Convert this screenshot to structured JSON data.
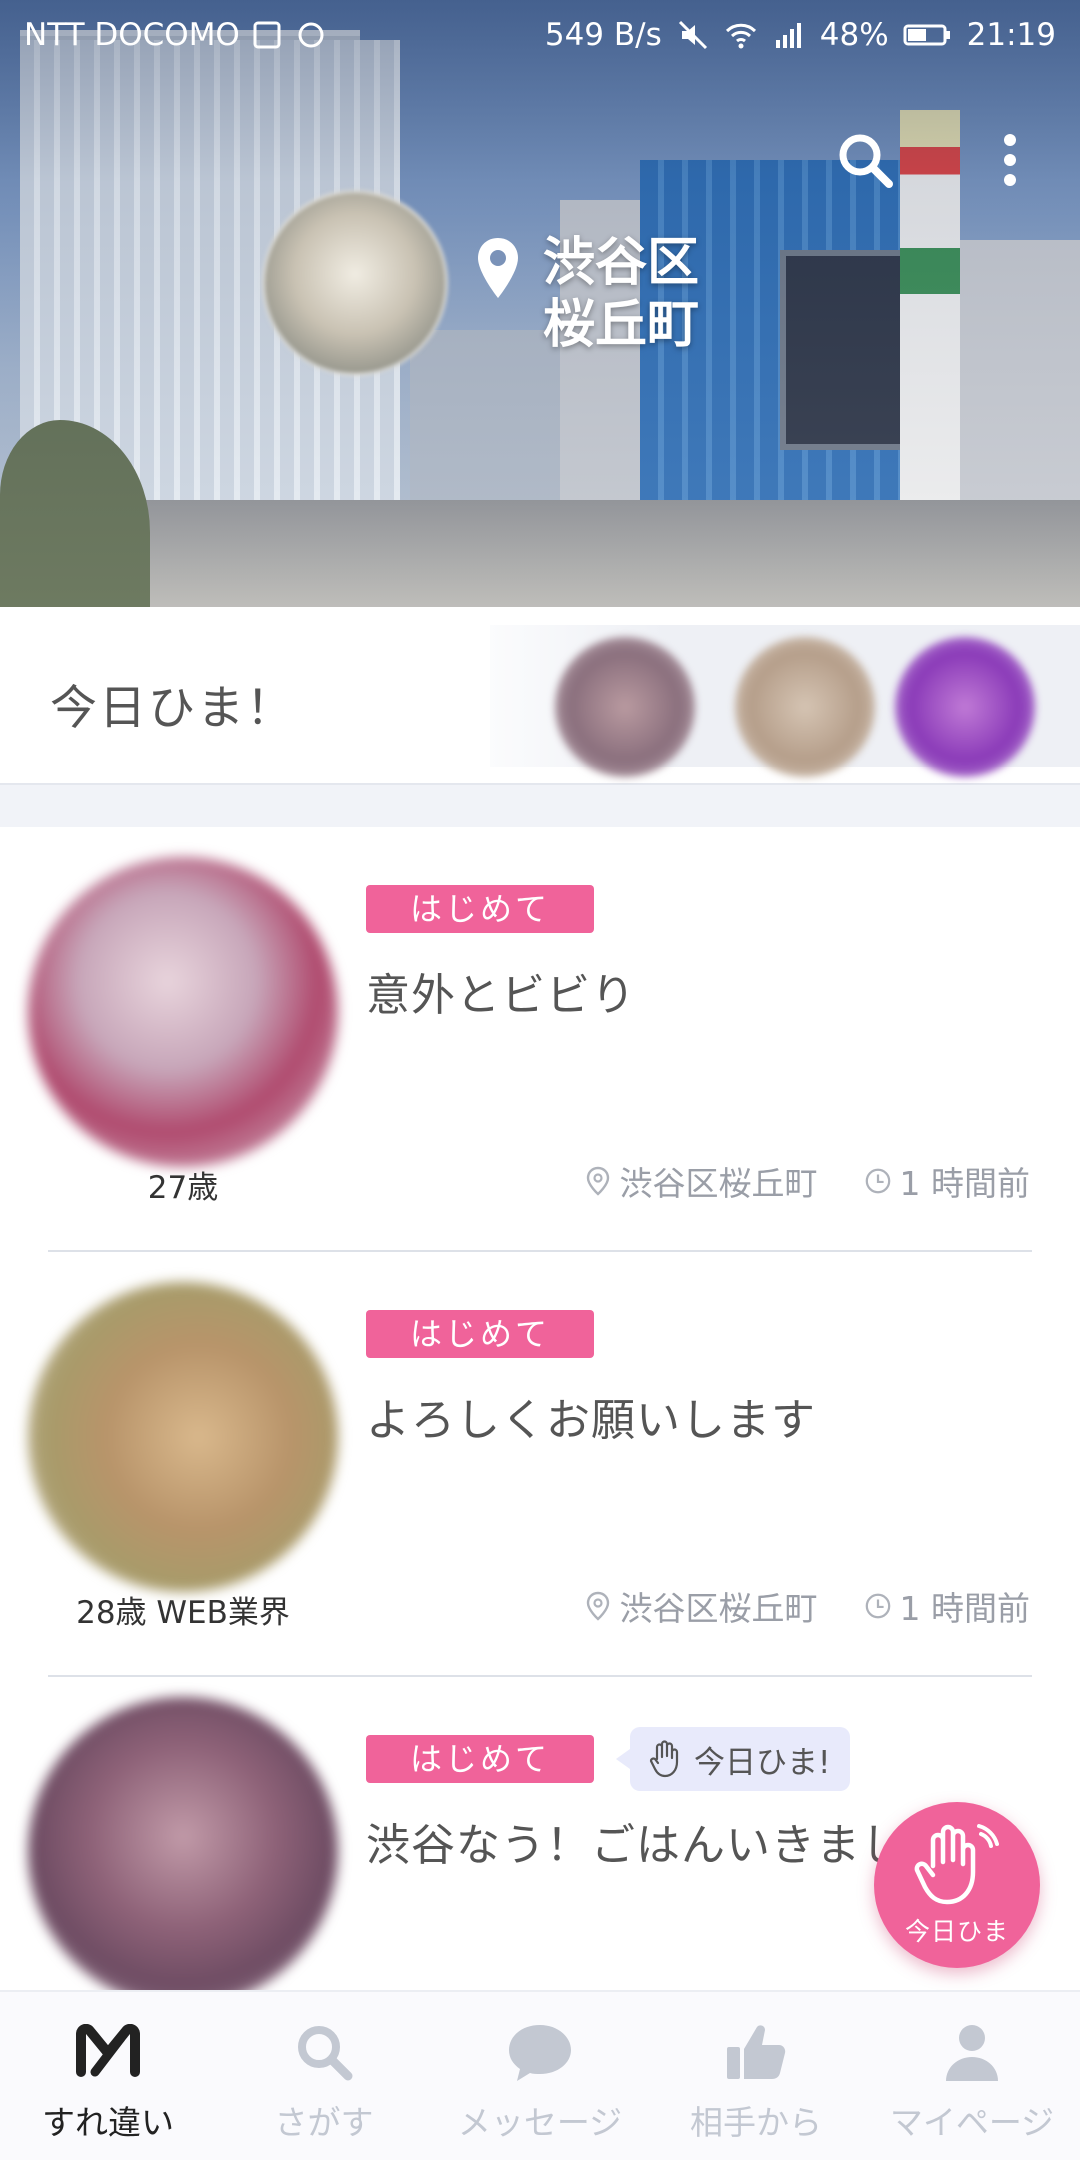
{
  "status_bar": {
    "carrier": "NTT DOCOMO",
    "net_speed": "549 B/s",
    "battery": "48%",
    "time": "21:19"
  },
  "header": {
    "location_line1": "渋谷区",
    "location_line2": "桜丘町"
  },
  "today_hima": {
    "title": "今日ひま！"
  },
  "posts": [
    {
      "badge": "はじめて",
      "message": "意外とビビり",
      "meta": "27歳",
      "location": "渋谷区桜丘町",
      "time": "1 時間前"
    },
    {
      "badge": "はじめて",
      "message": "よろしくお願いします",
      "meta": "28歳 WEB業界",
      "location": "渋谷区桜丘町",
      "time": "1 時間前"
    },
    {
      "badge": "はじめて",
      "hima_tag": "今日ひま!",
      "message": "渋谷なう！ごはんいきまし"
    }
  ],
  "fab": {
    "label": "今日ひま"
  },
  "bottom_nav": {
    "items": [
      {
        "label": "すれ違い",
        "icon": "surechigai-logo-icon",
        "active": true
      },
      {
        "label": "さがす",
        "icon": "search-icon",
        "active": false
      },
      {
        "label": "メッセージ",
        "icon": "chat-bubble-icon",
        "active": false
      },
      {
        "label": "相手から",
        "icon": "thumbs-up-icon",
        "active": false
      },
      {
        "label": "マイページ",
        "icon": "person-icon",
        "active": false
      }
    ]
  },
  "colors": {
    "accent_pink": "#f0639a",
    "nav_inactive": "#c3c8d2",
    "nav_active": "#222222"
  }
}
